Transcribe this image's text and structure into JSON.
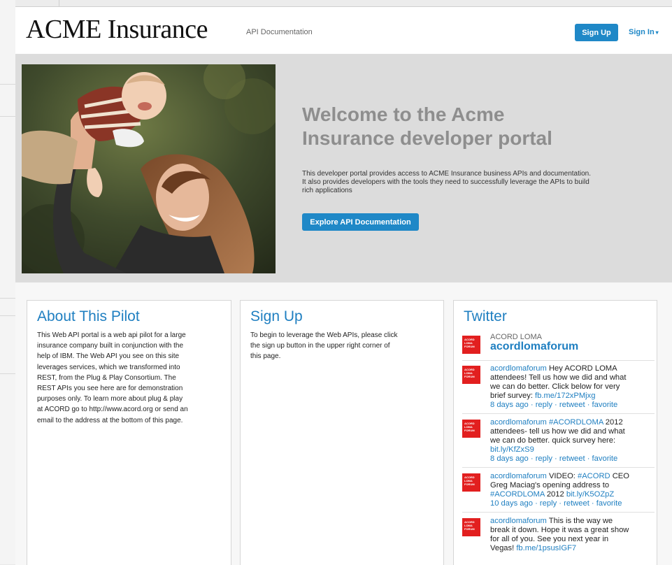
{
  "header": {
    "logo": "ACME Insurance",
    "nav_api_docs": "API Documentation",
    "signup_label": "Sign Up",
    "signin_label": "Sign In",
    "accent": "#1f88c7"
  },
  "hero": {
    "title": "Welcome to the Acme Insurance developer portal",
    "text": "This developer portal provides access to ACME Insurance business APIs and documentation. It also provides developers with the tools they need to successfully leverage the APIs to build rich applications",
    "button_label": "Explore API Documentation"
  },
  "about": {
    "title": "About This Pilot",
    "lines": [
      "This Web API portal is a web api pilot for a large",
      "insurance company built in conjunction with the",
      "help of IBM.  The Web API you see on this site",
      "leverages services, which we transformed into",
      "REST, from the Plug & Play Consortium. The",
      "REST APIs you see here are for demonstration",
      "purposes only.  To learn more about plug & play",
      "at ACORD go to http://www.acord.org or send an",
      "email to the address at the bottom of this page."
    ]
  },
  "signup": {
    "title": "Sign Up",
    "lines": [
      "To begin to leverage the Web APIs, please click",
      "the sign up button in the upper right corner of",
      "this page."
    ]
  },
  "twitter": {
    "title": "Twitter",
    "logo_text": "ACORD LOMA FORUM",
    "account_name": "ACORD LOMA",
    "account_handle": "acordlomaforum",
    "tweets": [
      {
        "user": "acordlomaforum",
        "lines": [
          "Hey ACORD LOMA",
          "attendees! Tell us how we did and what",
          "we can do better. Click below for very",
          "brief survey: "
        ],
        "link": "fb.me/172xPMjxg",
        "time": "8 days ago",
        "reply": "reply",
        "retweet": "retweet",
        "favorite": "favorite"
      },
      {
        "user": "acordlomaforum",
        "hashtag": "#ACORDLOMA",
        "lines": [
          " 2012",
          "attendees- tell us how we did and what",
          "we can do better. quick survey here:"
        ],
        "link": "bit.ly/KfZxS9",
        "time": "8 days ago",
        "reply": "reply",
        "retweet": "retweet",
        "favorite": "favorite"
      },
      {
        "user": "acordlomaforum",
        "lead": "VIDEO: ",
        "hashtag": "#ACORD",
        "lines": [
          " CEO",
          "Greg Maciag's opening address to"
        ],
        "hashtag2": "#ACORDLOMA",
        "mid": " 2012 ",
        "link": "bit.ly/K5OZpZ",
        "time": "10 days ago",
        "reply": "reply",
        "retweet": "retweet",
        "favorite": "favorite"
      },
      {
        "user": "acordlomaforum",
        "lines": [
          "This is the way we",
          "break it down. Hope it was a great show",
          "for all of you. See you next year in",
          "Vegas! "
        ],
        "link": "fb.me/1psusIGF7"
      }
    ]
  }
}
